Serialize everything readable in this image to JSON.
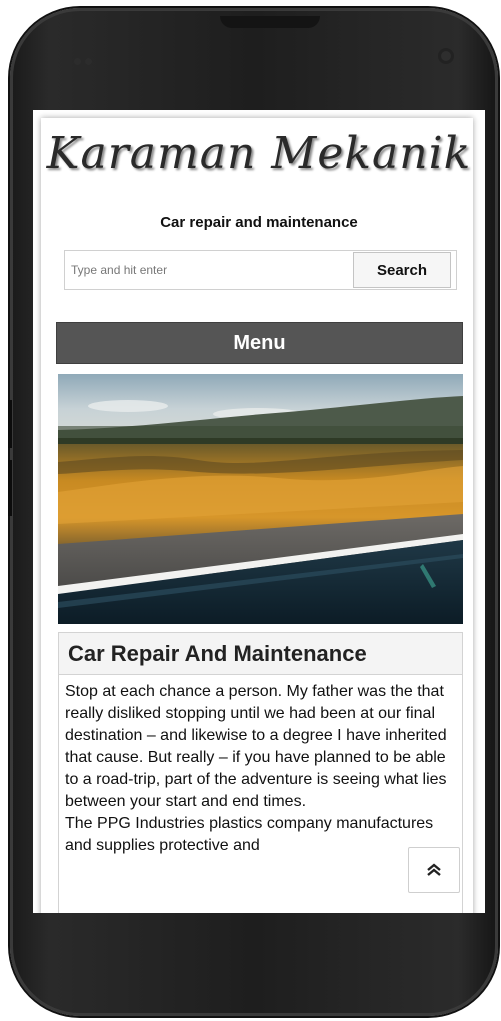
{
  "site": {
    "logo_text": "Karaman Mekanik",
    "tagline": "Car repair and maintenance"
  },
  "search": {
    "placeholder": "Type and hit enter",
    "button_label": "Search"
  },
  "menu": {
    "label": "Menu"
  },
  "post": {
    "title": "Car Repair And Maintenance",
    "paragraph_1": "Stop at each chance a person. My father was the that really disliked stopping until we had been at our final destination – and likewise to a degree I have inherited that cause. But really – if you have planned to be able to a road-trip, part of the adventure is seeing what lies between your start and end times.",
    "paragraph_2": "The PPG Industries plastics company manufactures and supplies protective and"
  },
  "icons": {
    "scroll_top": "chevron-double-up-icon"
  }
}
